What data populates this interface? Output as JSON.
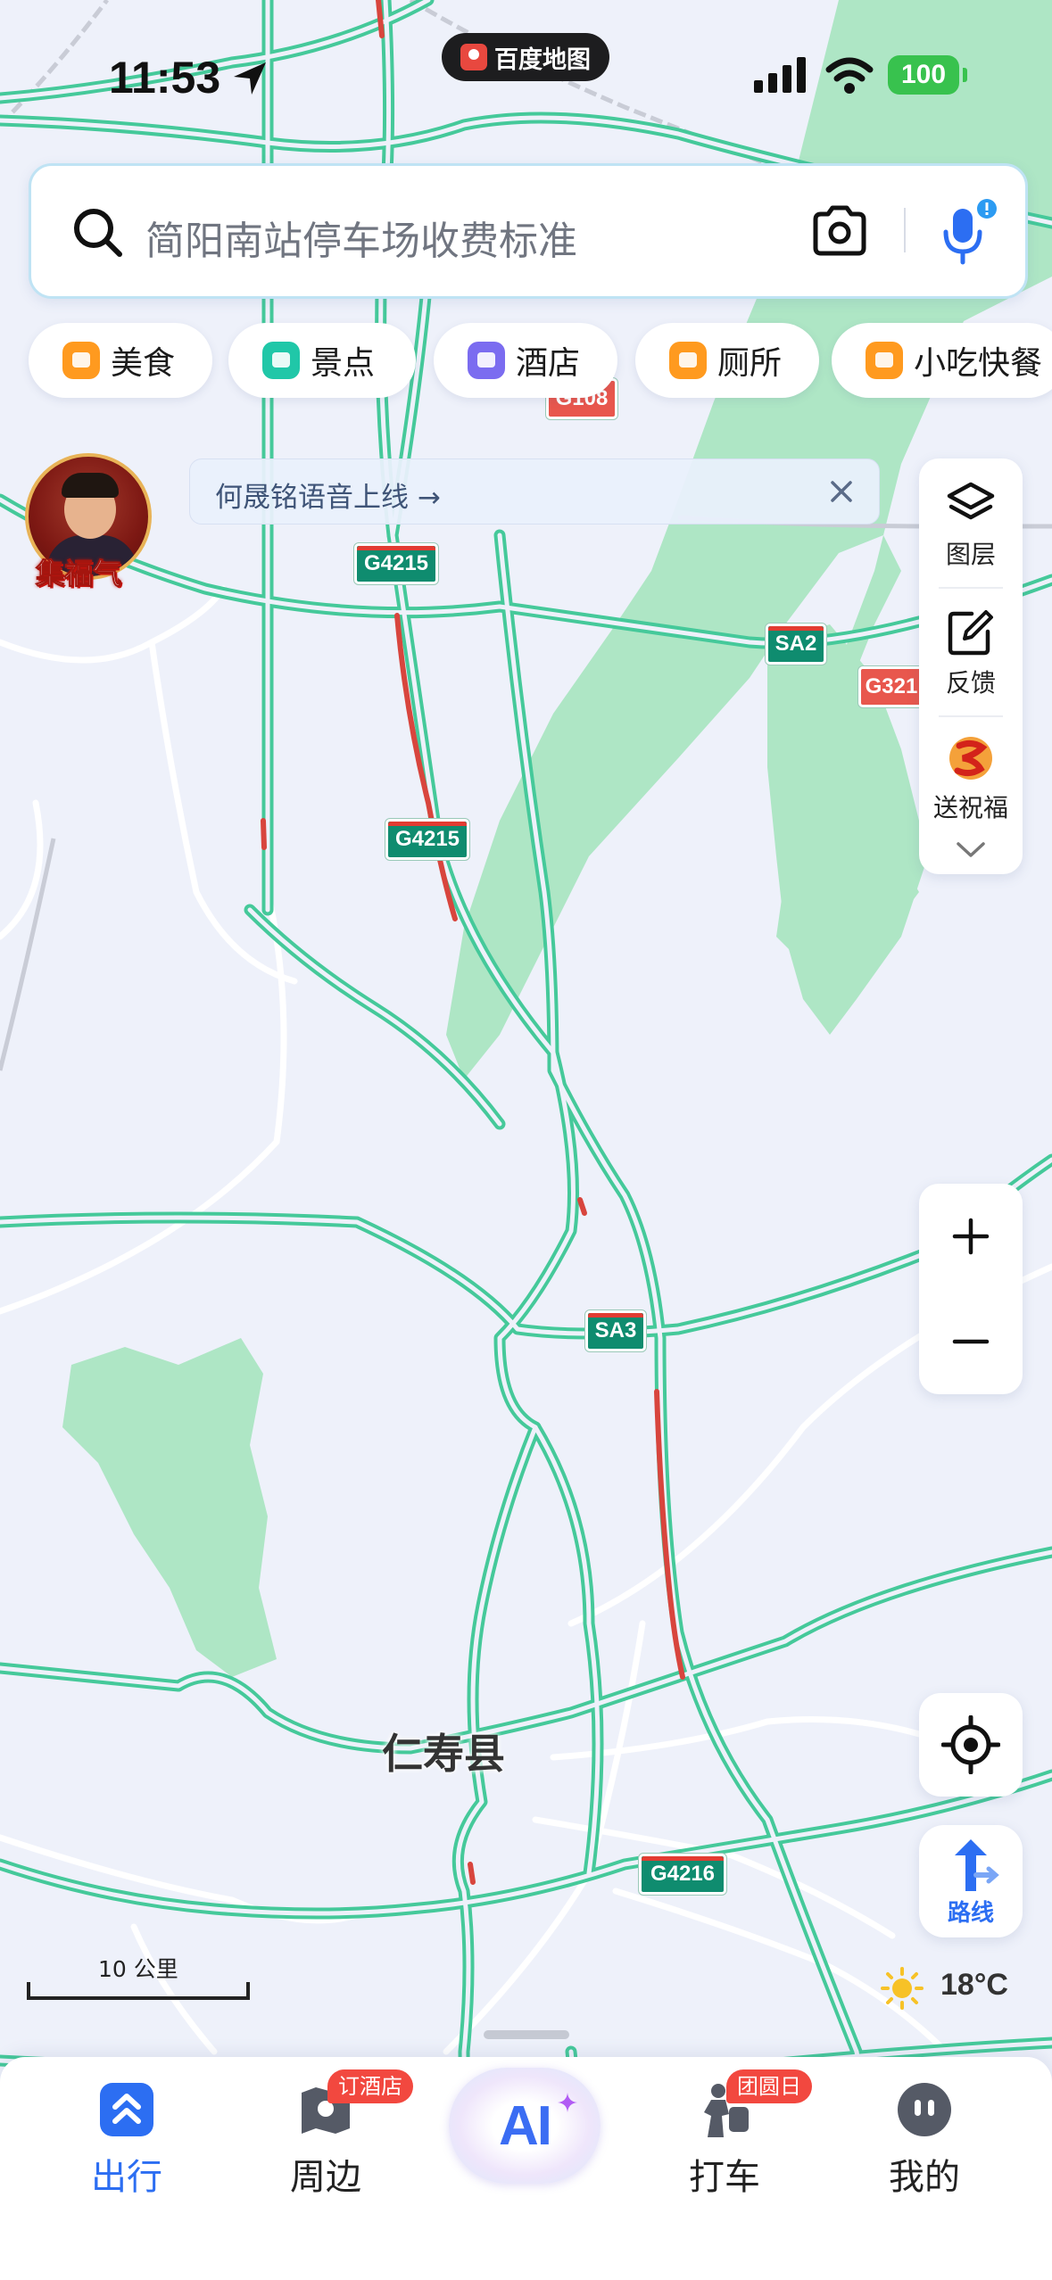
{
  "status_bar": {
    "time": "11:53",
    "app_name": "百度地图",
    "battery": "100"
  },
  "search": {
    "placeholder": "简阳南站停车场收费标准"
  },
  "chips": [
    {
      "label": "美食",
      "icon": "food-icon",
      "color": "#ff9a1f"
    },
    {
      "label": "景点",
      "icon": "scenery-icon",
      "color": "#20c7a8"
    },
    {
      "label": "酒店",
      "icon": "hotel-icon",
      "color": "#7b6cf0"
    },
    {
      "label": "厕所",
      "icon": "toilet-icon",
      "color": "#ff9a1f"
    },
    {
      "label": "小吃快餐",
      "icon": "snack-icon",
      "color": "#ff9a1f"
    }
  ],
  "promo": {
    "avatar_label": "集福气",
    "banner_text": "何晟铭语音上线 →"
  },
  "right_panel": {
    "layers": "图层",
    "feedback": "反馈",
    "blessing": "送祝福"
  },
  "map": {
    "city_label": "仁寿县",
    "road_badges": [
      "G108",
      "G4215",
      "SA2",
      "G321",
      "G4215",
      "SA3",
      "G4216"
    ]
  },
  "route": {
    "label": "路线"
  },
  "scale": {
    "label": "10 公里"
  },
  "weather": {
    "temperature": "18°C"
  },
  "tabbar": {
    "tabs": [
      {
        "label": "出行",
        "active": true
      },
      {
        "label": "周边",
        "badge": "订酒店"
      },
      {
        "label": "AI",
        "ai": true
      },
      {
        "label": "打车",
        "badge": "团圆日"
      },
      {
        "label": "我的"
      }
    ]
  },
  "colors": {
    "accent": "#2c6ef2",
    "road": "#45c99a",
    "congestion": "#d8453d",
    "park": "#a9e5c1",
    "map_bg": "#eef1fa"
  }
}
